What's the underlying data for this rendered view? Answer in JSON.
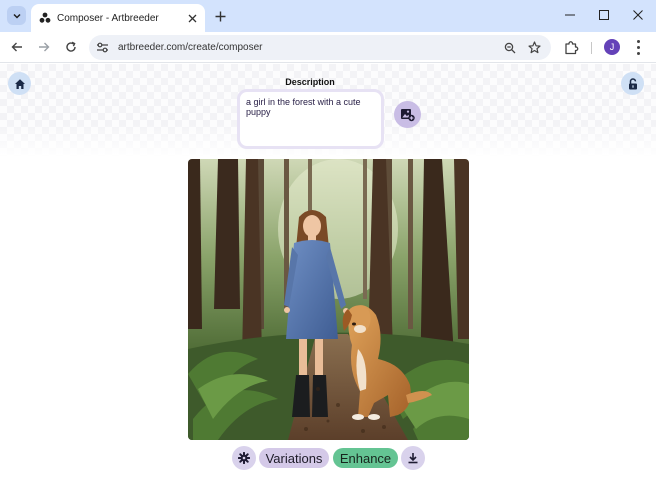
{
  "browser": {
    "tab_title": "Composer - Artbreeder",
    "url": "artbreeder.com/create/composer",
    "profile_initial": "J",
    "icons": {
      "tab_search": "chevron-down-icon",
      "favicon": "artbreeder-logo-icon",
      "tab_close": "close-icon",
      "new_tab": "plus-icon",
      "back": "arrow-left-icon",
      "forward": "arrow-right-icon",
      "reload": "reload-icon",
      "site_info": "tune-icon",
      "zoom": "zoom-icon",
      "bookmark": "star-icon",
      "extensions": "puzzle-icon",
      "menu": "more-vert-icon"
    },
    "colors": {
      "tabbar": "#d3e3fd",
      "avatar": "#6442b8"
    }
  },
  "composer": {
    "description_label": "Description",
    "description_text": "a girl in the forest with a cute puppy",
    "variations_label": "Variations",
    "enhance_label": "Enhance",
    "icons": {
      "home": "home-icon",
      "lock": "unlock-icon",
      "add_image": "add-image-icon",
      "settings": "gear-icon",
      "download": "download-icon"
    },
    "generated_image_subject": "a girl in a blue dress standing on a forest path with a golden puppy",
    "colors": {
      "enhance": "#64c493",
      "variations": "#d4c9e8",
      "icon_buttons": "#d9d2ec",
      "corner_buttons": "#cfe0f5"
    }
  }
}
